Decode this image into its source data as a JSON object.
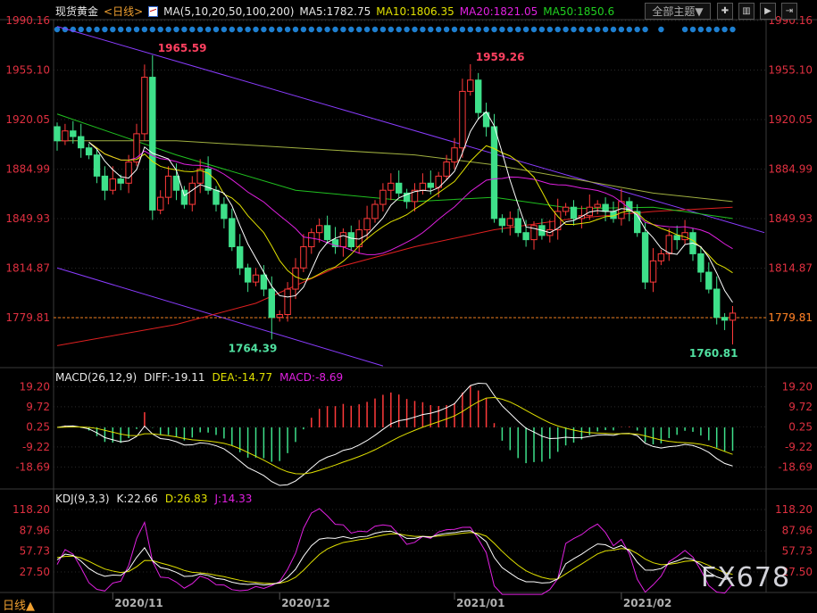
{
  "header": {
    "symbol": "现货黄金",
    "period_tag": "<日线>",
    "ma_params": "MA(5,10,20,50,100,200)",
    "ma5": "MA5:1782.75",
    "ma10": "MA10:1806.35",
    "ma20": "MA20:1821.05",
    "ma50": "MA50:1850.6",
    "theme_button": "全部主题▼",
    "toolbar_icons": [
      "grid-icon",
      "chart-type-icon",
      "play-icon",
      "exit-icon"
    ]
  },
  "macd_header": {
    "name": "MACD(26,12,9)",
    "diff": "DIFF:-19.11",
    "dea": "DEA:-14.77",
    "macd": "MACD:-8.69"
  },
  "kdj_header": {
    "name": "KDJ(9,3,3)",
    "k": "K:22.66",
    "d": "D:26.83",
    "j": "J:14.33"
  },
  "period_button": "日线▲",
  "watermark": "FX678",
  "colors": {
    "up": "#ff3a3a",
    "down": "#3ee08a",
    "ma5": "#ffffff",
    "ma10": "#e0e000",
    "ma20": "#e020e0",
    "ma50": "#20c020",
    "ma100": "#a0b040",
    "ma200": "#e02020",
    "trend": "#8a3cff",
    "axis": "#e03040",
    "signal_dot": "#1e7fd0"
  },
  "chart_data": {
    "type": "candlestick",
    "title": "现货黄金 日线",
    "price_axis_labels": [
      "1990.16",
      "1955.10",
      "1920.05",
      "1884.99",
      "1849.93",
      "1814.87",
      "1779.81"
    ],
    "price_ylim": [
      1745,
      1995
    ],
    "current_price": "1779.81",
    "annotations": [
      {
        "index": 12,
        "type": "high",
        "value": 1965.59,
        "label": "1965.59"
      },
      {
        "index": 52,
        "type": "high",
        "value": 1959.26,
        "label": "1959.26"
      },
      {
        "index": 27,
        "type": "low",
        "value": 1764.39,
        "label": "1764.39"
      },
      {
        "index": 85,
        "type": "low",
        "value": 1760.81,
        "label": "1760.81"
      }
    ],
    "closes": [
      1905,
      1912,
      1908,
      1900,
      1895,
      1880,
      1870,
      1878,
      1875,
      1890,
      1910,
      1950,
      1856,
      1865,
      1880,
      1870,
      1860,
      1875,
      1885,
      1870,
      1860,
      1850,
      1830,
      1815,
      1805,
      1810,
      1800,
      1780,
      1782,
      1800,
      1815,
      1830,
      1840,
      1845,
      1835,
      1830,
      1840,
      1830,
      1842,
      1850,
      1860,
      1870,
      1875,
      1868,
      1862,
      1870,
      1875,
      1872,
      1880,
      1890,
      1900,
      1940,
      1948,
      1925,
      1915,
      1850,
      1845,
      1850,
      1840,
      1835,
      1845,
      1838,
      1842,
      1855,
      1858,
      1850,
      1852,
      1858,
      1860,
      1855,
      1850,
      1862,
      1855,
      1840,
      1805,
      1820,
      1825,
      1838,
      1835,
      1840,
      1825,
      1812,
      1800,
      1780,
      1778,
      1783
    ],
    "first_open": 1915,
    "ma50": [
      [
        0,
        1924
      ],
      [
        15,
        1895
      ],
      [
        30,
        1870
      ],
      [
        45,
        1862
      ],
      [
        55,
        1865
      ],
      [
        65,
        1857
      ],
      [
        75,
        1858
      ],
      [
        85,
        1850
      ]
    ],
    "ma100": [
      [
        0,
        1905
      ],
      [
        15,
        1905
      ],
      [
        30,
        1900
      ],
      [
        45,
        1895
      ],
      [
        55,
        1888
      ],
      [
        65,
        1878
      ],
      [
        75,
        1868
      ],
      [
        85,
        1862
      ]
    ],
    "ma200": [
      [
        0,
        1760
      ],
      [
        15,
        1775
      ],
      [
        25,
        1790
      ],
      [
        35,
        1815
      ],
      [
        45,
        1830
      ],
      [
        55,
        1842
      ],
      [
        65,
        1850
      ],
      [
        75,
        1855
      ],
      [
        85,
        1858
      ]
    ],
    "trendlines": [
      {
        "name": "upper-channel",
        "points": [
          [
            0,
            1986
          ],
          [
            89,
            1840
          ]
        ]
      },
      {
        "name": "lower-channel",
        "points": [
          [
            0,
            1815
          ],
          [
            41,
            1745.6
          ]
        ]
      }
    ],
    "x_ticks": [
      {
        "index": 7,
        "label": "2020/11"
      },
      {
        "index": 28,
        "label": "2020/12"
      },
      {
        "index": 50,
        "label": "2021/01"
      },
      {
        "index": 71,
        "label": "2021/02"
      }
    ],
    "macd_axis_labels": [
      "19.20",
      "9.72",
      "0.25",
      "-9.22",
      "-18.69"
    ],
    "kdj_axis_labels": [
      "118.20",
      "87.96",
      "57.73",
      "27.50"
    ]
  }
}
